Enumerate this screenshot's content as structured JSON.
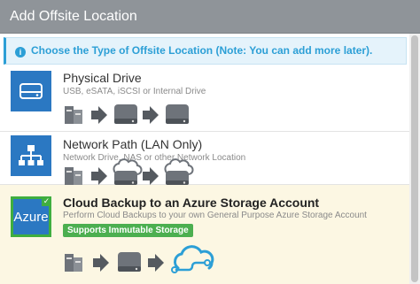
{
  "dialog": {
    "title": "Add Offsite Location"
  },
  "banner": {
    "text": "Choose the Type of Offsite Location (Note: You can add more later)."
  },
  "options": [
    {
      "title": "Physical Drive",
      "description": "USB, eSATA, iSCSI or Internal Drive",
      "icon": "hard-drive-icon"
    },
    {
      "title": "Network Path (LAN Only)",
      "description": "Network Drive, NAS or other Network Location",
      "icon": "network-icon"
    },
    {
      "title": "Cloud Backup to an Azure Storage Account",
      "description": "Perform Cloud Backups to your own General Purpose Azure Storage Account",
      "icon_text": "Azure",
      "badge": "Supports Immutable Storage",
      "selected": true
    }
  ],
  "colors": {
    "titlebar": "#8f9499",
    "accent_blue": "#2b78c2",
    "info_blue": "#2c9fd6",
    "selected_bg": "#fcf7e3",
    "green": "#3fae3f",
    "flow_gray": "#555a60"
  }
}
